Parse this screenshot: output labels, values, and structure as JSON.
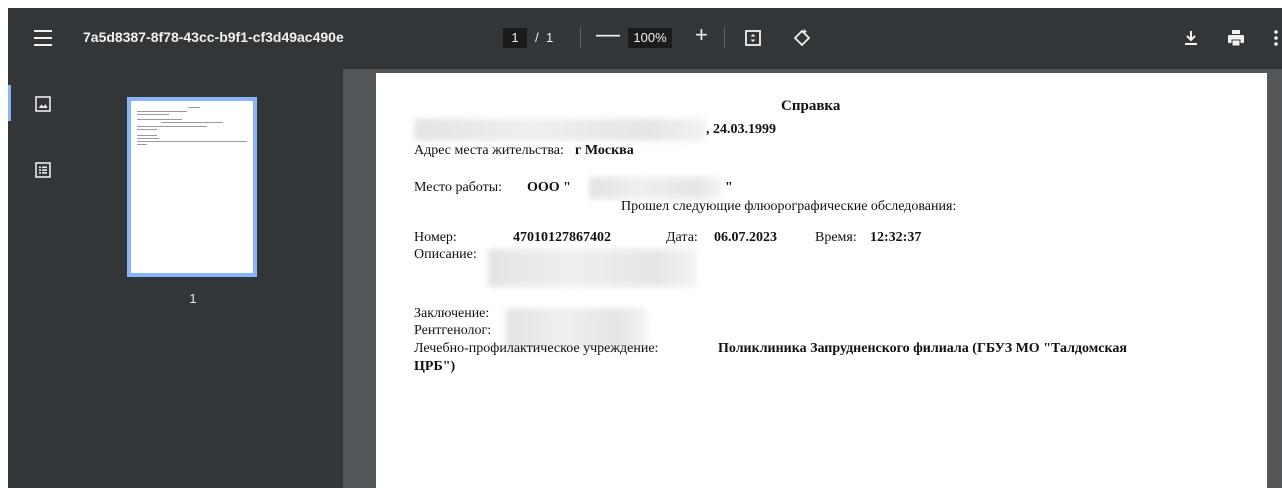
{
  "toolbar": {
    "title": "7a5d8387-8f78-43cc-b9f1-cf3d49ac490e",
    "page_current": "1",
    "page_separator": "/",
    "page_total": "1",
    "zoom_minus": "—",
    "zoom": "100%",
    "zoom_plus": "+"
  },
  "sidebar": {
    "thumbnail_page_number": "1"
  },
  "document": {
    "heading": "Справка",
    "birth_date": ", 24.03.1999",
    "address_label": "Адрес места жительства:",
    "address_value": "г Москва",
    "work_label": "Место работы:",
    "work_org_prefix": "ООО \"",
    "work_org_suffix": "\"",
    "exams_text": "Прошел следующие флюорографические обследования:",
    "number_label": "Номер:",
    "number_value": "47010127867402",
    "date_label": "Дата:",
    "date_value": "06.07.2023",
    "time_label": "Время:",
    "time_value": "12:32:37",
    "description_label": "Описание:",
    "conclusion_label": "Заключение:",
    "radiologist_label": "Рентгенолог:",
    "institution_label": "Лечебно-профилактическое учреждение:",
    "institution_value_line1": "Поликлиника Запрудненского филиала (ГБУЗ МО \"Талдомская",
    "institution_value_line2": "ЦРБ\")"
  },
  "colors": {
    "toolbar_bg": "#323639",
    "viewer_bg": "#525659",
    "accent": "#8ab4f8"
  }
}
